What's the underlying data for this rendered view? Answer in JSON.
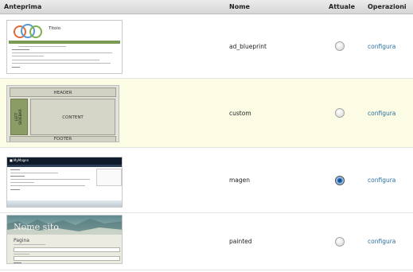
{
  "columns": {
    "preview": "Anteprima",
    "name": "Nome",
    "current": "Attuale",
    "operations": "Operazioni"
  },
  "themes": [
    {
      "name": "ad_blueprint",
      "current": false,
      "action": "configura",
      "thumb": {
        "site_title": "Titolo"
      }
    },
    {
      "name": "custom",
      "current": false,
      "action": "configura",
      "highlighted": true,
      "thumb": {
        "header": "HEADER",
        "sidebar": "LEFT\nSIDEBAR",
        "content": "CONTENT",
        "footer": "FOOTER"
      }
    },
    {
      "name": "magen",
      "current": true,
      "action": "configura",
      "thumb": {
        "brand": "■ MyMagen"
      }
    },
    {
      "name": "painted",
      "current": false,
      "action": "configura",
      "thumb": {
        "site_title": "Nome sito",
        "page_title": "Pagina"
      }
    }
  ],
  "colors": {
    "link": "#2a6f9f",
    "highlight_row": "#fcfce4"
  }
}
